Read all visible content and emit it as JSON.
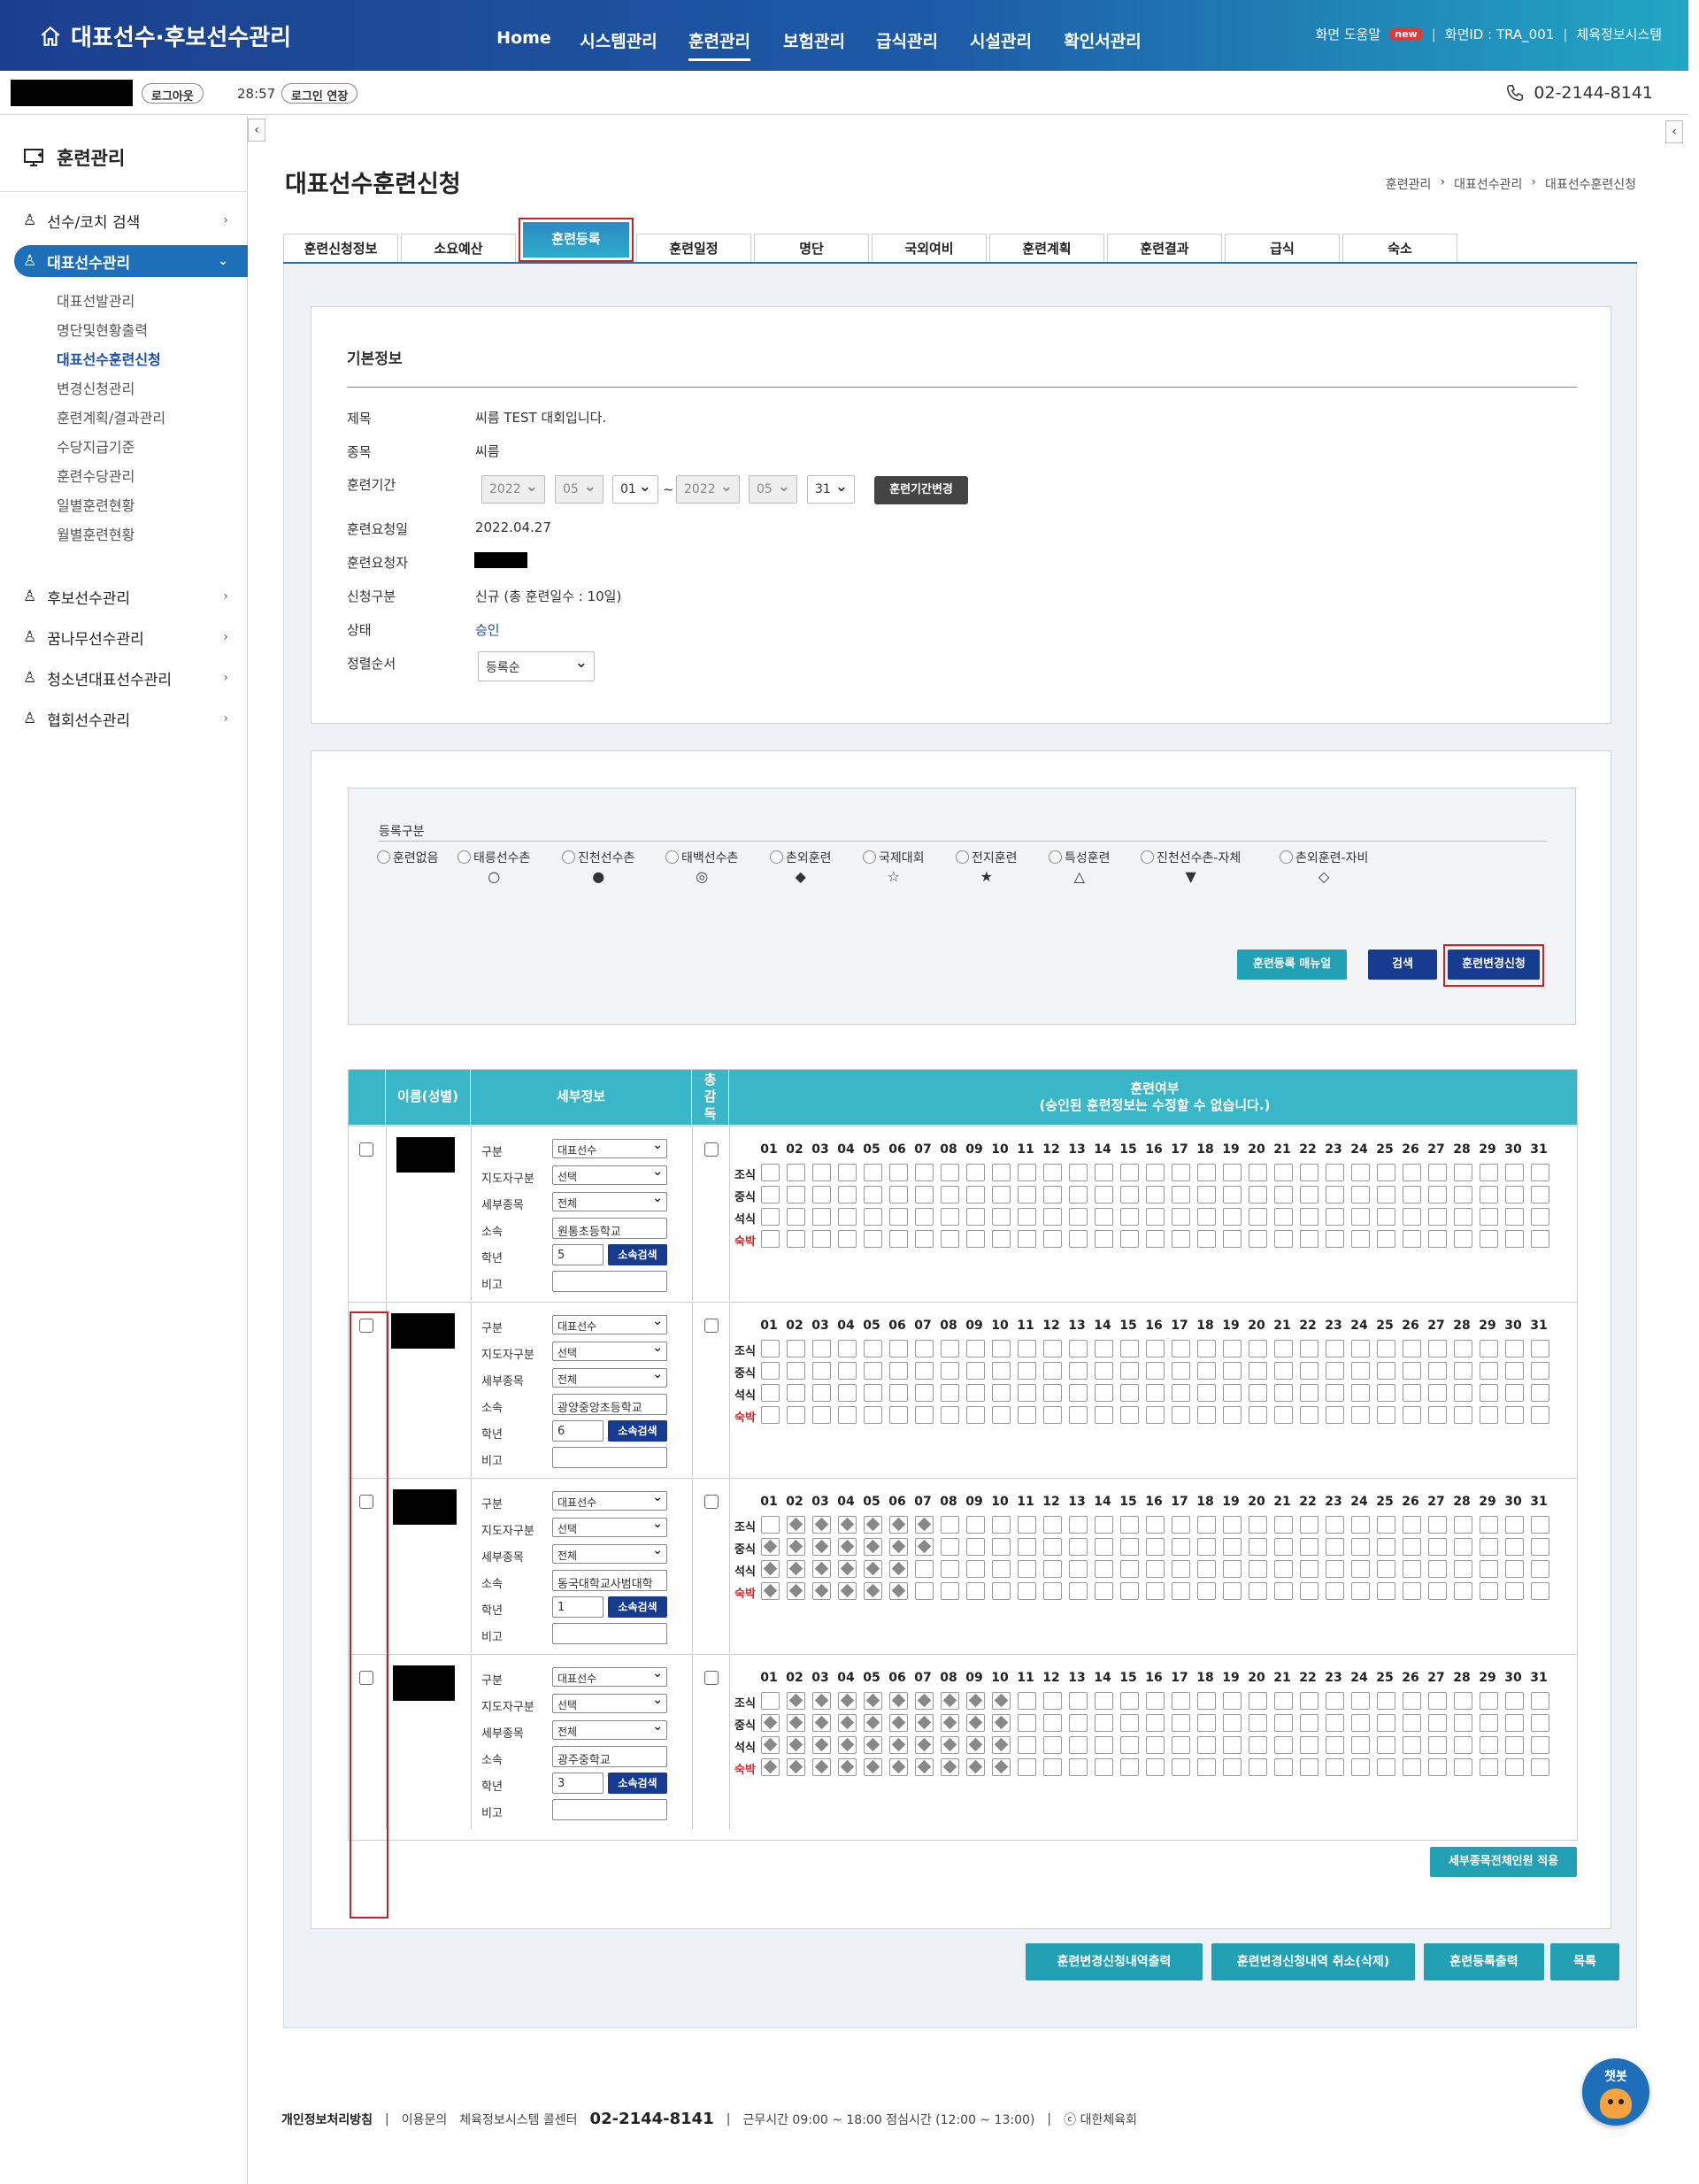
{
  "header": {
    "logo": "대표선수·후보선수관리",
    "nav": [
      {
        "label": "Home",
        "active": false
      },
      {
        "label": "시스템관리",
        "active": false
      },
      {
        "label": "훈련관리",
        "active": true
      },
      {
        "label": "보험관리",
        "active": false
      },
      {
        "label": "급식관리",
        "active": false
      },
      {
        "label": "시설관리",
        "active": false
      },
      {
        "label": "확인서관리",
        "active": false
      }
    ],
    "help": "화면 도움말",
    "help_badge": "new",
    "screen_id": "화면ID : TRA_001",
    "system": "체육정보시스템"
  },
  "subbar": {
    "logout": "로그아웃",
    "timer": "28:57",
    "extend": "로그인 연장",
    "phone": "02-2144-8141"
  },
  "sidebar": {
    "title": "훈련관리",
    "items": [
      {
        "label": "선수/코치 검색",
        "active": false
      },
      {
        "label": "대표선수관리",
        "active": true
      },
      {
        "label": "후보선수관리",
        "active": false
      },
      {
        "label": "꿈나무선수관리",
        "active": false
      },
      {
        "label": "청소년대표선수관리",
        "active": false
      },
      {
        "label": "협회선수관리",
        "active": false
      }
    ],
    "subitems": [
      {
        "label": "대표선발관리",
        "active": false
      },
      {
        "label": "명단및현황출력",
        "active": false
      },
      {
        "label": "대표선수훈련신청",
        "active": true
      },
      {
        "label": "변경신청관리",
        "active": false
      },
      {
        "label": "훈련계획/결과관리",
        "active": false
      },
      {
        "label": "수당지급기준",
        "active": false
      },
      {
        "label": "훈련수당관리",
        "active": false
      },
      {
        "label": "일별훈련현황",
        "active": false
      },
      {
        "label": "월별훈련현황",
        "active": false
      }
    ]
  },
  "page": {
    "title": "대표선수훈련신청",
    "breadcrumb": [
      "훈련관리",
      "›",
      "대표선수관리",
      "›",
      "대표선수훈련신청"
    ]
  },
  "tabs": [
    "훈련신청정보",
    "소요예산",
    "훈련등록",
    "훈련일정",
    "명단",
    "국외여비",
    "훈련계획",
    "훈련결과",
    "급식",
    "숙소"
  ],
  "active_tab": "훈련등록",
  "basic": {
    "section_title": "기본정보",
    "labels": {
      "subject": "제목",
      "sport": "종목",
      "period": "훈련기간",
      "request_date": "훈련요청일",
      "requester": "훈련요청자",
      "type": "신청구분",
      "status": "상태",
      "sort": "정렬순서"
    },
    "subject": "씨름 TEST 대회입니다.",
    "sport": "씨름",
    "period": {
      "from_year": "2022",
      "from_month": "05",
      "from_day": "01",
      "tilde": "~",
      "to_year": "2022",
      "to_month": "05",
      "to_day": "31",
      "change_button": "훈련기간변경"
    },
    "request_date": "2022.04.27",
    "type": "신규 (총 훈련일수 : 10일)",
    "status": "승인",
    "sort": "등록순"
  },
  "registration": {
    "title": "등록구분",
    "options": [
      {
        "label": "훈련없음",
        "symbol": ""
      },
      {
        "label": "태릉선수촌",
        "symbol": "○"
      },
      {
        "label": "진천선수촌",
        "symbol": "●"
      },
      {
        "label": "태백선수촌",
        "symbol": "◎"
      },
      {
        "label": "촌외훈련",
        "symbol": "◆"
      },
      {
        "label": "국제대회",
        "symbol": "☆"
      },
      {
        "label": "전지훈련",
        "symbol": "★"
      },
      {
        "label": "특성훈련",
        "symbol": "△"
      },
      {
        "label": "진천선수촌-자체",
        "symbol": "▼"
      },
      {
        "label": "촌외훈련-자비",
        "symbol": "◇"
      }
    ],
    "buttons": {
      "manual": "훈련등록 매뉴얼",
      "search": "검색",
      "change": "훈련변경신청"
    }
  },
  "grid": {
    "headers": {
      "name": "이름(성별)",
      "detail": "세부정보",
      "supervise": "총감독",
      "training": "훈련여부",
      "training_note": "(승인된 훈련정보는 수정할 수 없습니다.)"
    },
    "detail_labels": {
      "division": "구분",
      "coach_division": "지도자구분",
      "sub_event": "세부종목",
      "affiliation": "소속",
      "grade": "학년",
      "remark": "비고"
    },
    "search_button": "소속검색",
    "meals": [
      "조식",
      "중식",
      "석식",
      "숙박"
    ],
    "days": [
      "01",
      "02",
      "03",
      "04",
      "05",
      "06",
      "07",
      "08",
      "09",
      "10",
      "11",
      "12",
      "13",
      "14",
      "15",
      "16",
      "17",
      "18",
      "19",
      "20",
      "21",
      "22",
      "23",
      "24",
      "25",
      "26",
      "27",
      "28",
      "29",
      "30",
      "31"
    ],
    "rows": [
      {
        "division": "대표선수",
        "coach_division": "선택",
        "sub_event": "전체",
        "affiliation": "원통초등학교",
        "grade": "5",
        "remark": "",
        "marks": [
          [],
          [],
          [],
          []
        ]
      },
      {
        "division": "대표선수",
        "coach_division": "선택",
        "sub_event": "전체",
        "affiliation": "광양중앙초등학교",
        "grade": "6",
        "remark": "",
        "marks": [
          [],
          [],
          [],
          []
        ]
      },
      {
        "division": "대표선수",
        "coach_division": "선택",
        "sub_event": "전체",
        "affiliation": "동국대학교사범대학",
        "grade": "1",
        "remark": "",
        "marks": [
          [
            2,
            3,
            4,
            5,
            6,
            7
          ],
          [
            1,
            2,
            3,
            4,
            5,
            6,
            7
          ],
          [
            1,
            2,
            3,
            4,
            5,
            6
          ],
          [
            1,
            2,
            3,
            4,
            5,
            6
          ]
        ]
      },
      {
        "division": "대표선수",
        "coach_division": "선택",
        "sub_event": "전체",
        "affiliation": "광주중학교",
        "grade": "3",
        "remark": "",
        "marks": [
          [
            2,
            3,
            4,
            5,
            6,
            7,
            8,
            9,
            10
          ],
          [
            1,
            2,
            3,
            4,
            5,
            6,
            7,
            8,
            9,
            10
          ],
          [
            1,
            2,
            3,
            4,
            5,
            6,
            7,
            8,
            9,
            10
          ],
          [
            1,
            2,
            3,
            4,
            5,
            6,
            7,
            8,
            9,
            10
          ]
        ]
      }
    ],
    "apply_button": "세부종목전체인원 적용"
  },
  "bottom_buttons": [
    "훈련변경신청내역출력",
    "훈련변경신청내역 취소(삭제)",
    "훈련등록출력",
    "목록"
  ],
  "footer": {
    "privacy": "개인정보처리방침",
    "inquiry": "이용문의",
    "center": "체육정보시스템 콜센터",
    "phone": "02-2144-8141",
    "hours": "근무시간 09:00 ~ 18:00  점심시간 (12:00 ~ 13:00)",
    "copyright": "ⓒ 대한체육회"
  },
  "chatbot": "챗봇",
  "colors": {
    "header_start": "#1b3f8e",
    "header_end": "#22a6c4",
    "teal": "#23a1b4",
    "navy": "#173b8f",
    "grid_head": "#39b6c7",
    "highlight": "#cc2222"
  }
}
